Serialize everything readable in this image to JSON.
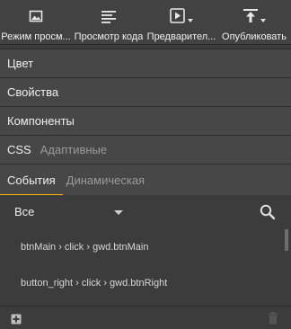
{
  "toolbar": {
    "items": [
      {
        "label": "Режим просм...",
        "icon": "image-icon"
      },
      {
        "label": "Просмотр кода",
        "icon": "code-view-icon"
      },
      {
        "label": "Предварител...",
        "icon": "preview-play-icon"
      },
      {
        "label": "Опубликовать",
        "icon": "publish-icon"
      }
    ]
  },
  "sections": {
    "color": "Цвет",
    "properties": "Свойства",
    "components": "Компоненты",
    "css": "CSS",
    "adaptive": "Адаптивные"
  },
  "tabs": {
    "events": "События",
    "dynamic": "Динамическая"
  },
  "filter": {
    "selected": "Все"
  },
  "events": [
    "btnMain › click › gwd.btnMain",
    "button_right › click › gwd.btnRight"
  ],
  "colors": {
    "accent": "#f5b400",
    "panel": "#474747",
    "background": "#3c3c3c"
  }
}
